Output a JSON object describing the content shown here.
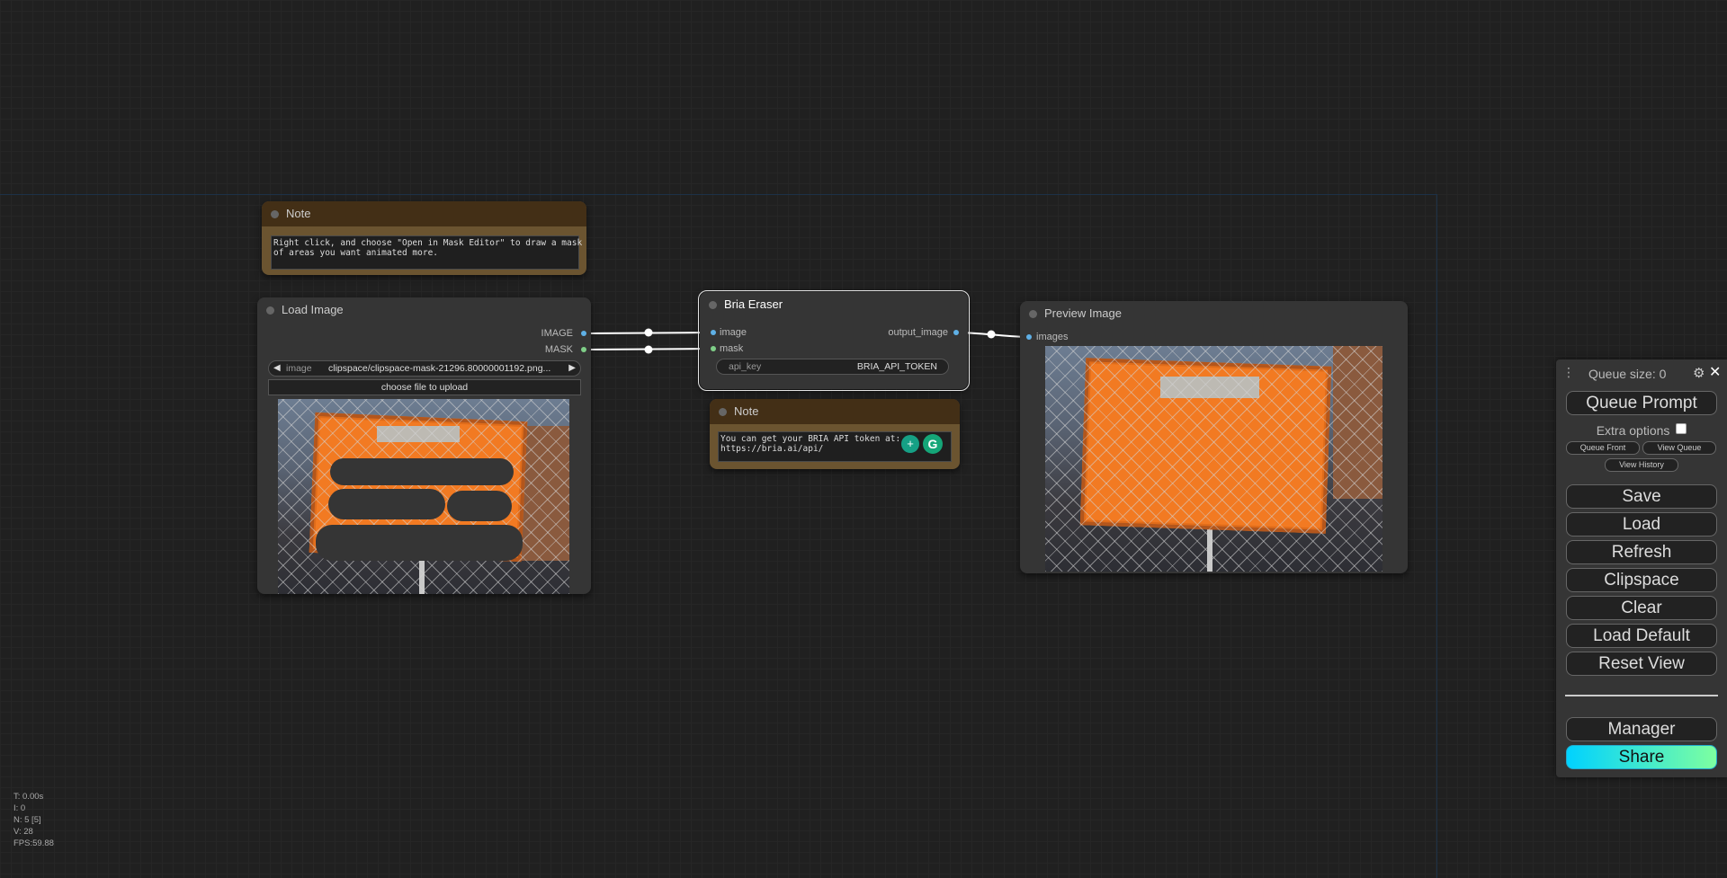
{
  "canvas": {
    "grid_color": "#262626",
    "background": "#202020"
  },
  "note_top": {
    "title": "Note",
    "text": "Right click, and choose \"Open in Mask Editor\" to draw a mask\nof areas you want animated more."
  },
  "load_image": {
    "title": "Load Image",
    "outputs": [
      "IMAGE",
      "MASK"
    ],
    "widget_label": "image",
    "widget_value": "clipspace/clipspace-mask-21296.80000001192.png...",
    "upload_label": "choose file to upload"
  },
  "bria_eraser": {
    "title": "Bria Eraser",
    "inputs": [
      "image",
      "mask"
    ],
    "output": "output_image",
    "api_key_label": "api_key",
    "api_key_value": "BRIA_API_TOKEN"
  },
  "note_bria": {
    "title": "Note",
    "text": "You can get your BRIA API token at:\nhttps://bria.ai/api/"
  },
  "preview_image": {
    "title": "Preview Image",
    "input": "images"
  },
  "panel": {
    "queue_size": "Queue size: 0",
    "queue_prompt": "Queue Prompt",
    "extra_options": "Extra options",
    "queue_front": "Queue Front",
    "view_queue": "View Queue",
    "view_history": "View History",
    "save": "Save",
    "load": "Load",
    "refresh": "Refresh",
    "clipspace": "Clipspace",
    "clear": "Clear",
    "load_default": "Load Default",
    "reset_view": "Reset View",
    "manager": "Manager",
    "share": "Share",
    "share_gradient": [
      "#00d2ff",
      "#7dffa0"
    ]
  },
  "stats": {
    "t": "T: 0.00s",
    "i": "I: 0",
    "n": "N: 5 [5]",
    "v": "V: 28",
    "fps": "FPS:59.88"
  }
}
